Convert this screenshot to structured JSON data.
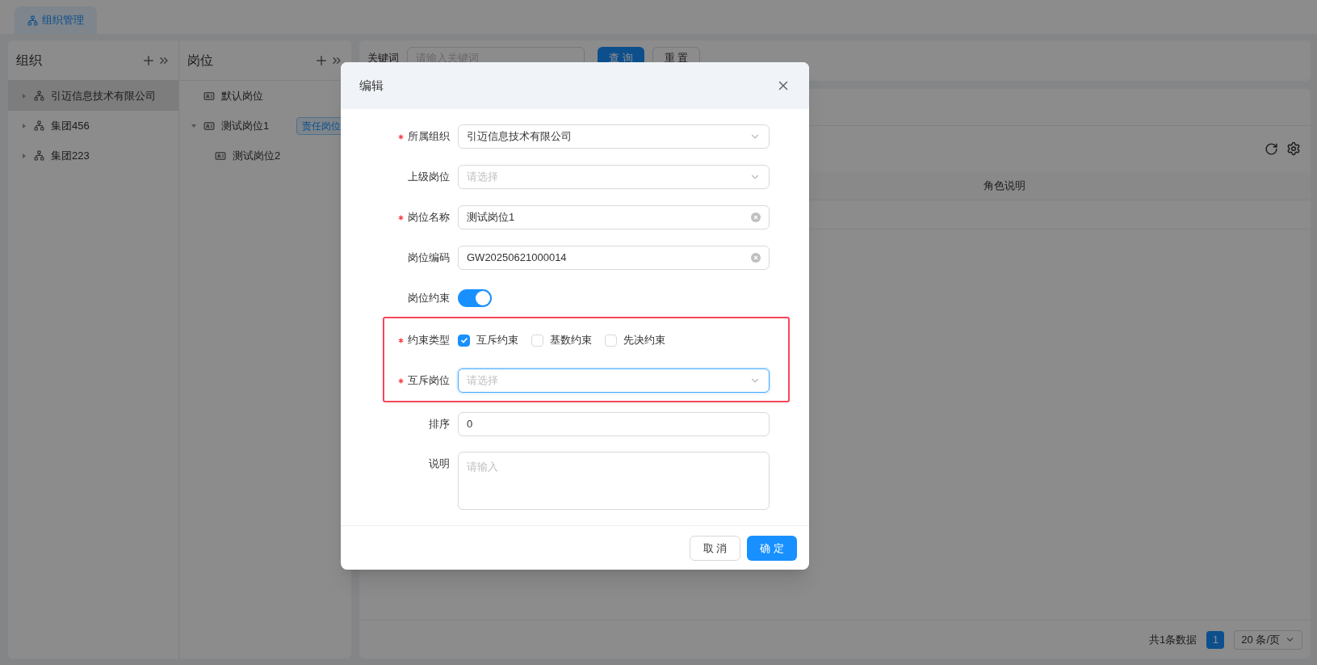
{
  "tabs": [
    {
      "label": "组织管理",
      "selected": true
    }
  ],
  "org_panel": {
    "title": "组织",
    "items": [
      {
        "label": "引迈信息技术有限公司",
        "selected": true
      },
      {
        "label": "集团456",
        "selected": false
      },
      {
        "label": "集团223",
        "selected": false
      }
    ]
  },
  "post_panel": {
    "title": "岗位",
    "items": [
      {
        "label": "默认岗位"
      },
      {
        "label": "测试岗位1",
        "badge": "责任岗位",
        "expanded": true,
        "children": [
          {
            "label": "测试岗位2"
          }
        ]
      }
    ]
  },
  "search": {
    "label": "关键词",
    "placeholder": "请输入关键词",
    "buttons": [
      {
        "label": "查 询",
        "kind": "primary"
      },
      {
        "label": "重 置",
        "kind": "default"
      }
    ]
  },
  "table": {
    "columns": [
      "角色说明"
    ]
  },
  "pagination": {
    "total": "共1条数据",
    "pages": [
      {
        "label": "1",
        "selected": true
      }
    ],
    "page_size": "20 条/页"
  },
  "dialog": {
    "title": "编辑",
    "fields": [
      {
        "kind": "select",
        "label": "所属组织",
        "required": true,
        "value": "引迈信息技术有限公司"
      },
      {
        "kind": "select",
        "label": "上级岗位",
        "required": false,
        "placeholder": "请选择"
      },
      {
        "kind": "input",
        "label": "岗位名称",
        "required": true,
        "value": "测试岗位1",
        "clearable": true
      },
      {
        "kind": "input",
        "label": "岗位编码",
        "required": false,
        "value": "GW20250621000014",
        "clearable": true
      },
      {
        "kind": "switch",
        "label": "岗位约束",
        "required": false,
        "on": true
      },
      {
        "kind": "annotation_box",
        "fields": [
          {
            "kind": "checkboxes",
            "label": "约束类型",
            "required": true,
            "options": [
              {
                "label": "互斥约束",
                "checked": true
              },
              {
                "label": "基数约束",
                "checked": false
              },
              {
                "label": "先决约束",
                "checked": false
              }
            ]
          },
          {
            "kind": "select",
            "label": "互斥岗位",
            "required": true,
            "placeholder": "请选择",
            "focused": true
          }
        ]
      },
      {
        "kind": "input",
        "label": "排序",
        "required": false,
        "value": "0",
        "clearable": false
      },
      {
        "kind": "textarea",
        "label": "说明",
        "required": false,
        "placeholder": "请输入"
      }
    ],
    "buttons": [
      {
        "label": "取 消",
        "kind": "default"
      },
      {
        "label": "确 定",
        "kind": "primary"
      }
    ]
  }
}
